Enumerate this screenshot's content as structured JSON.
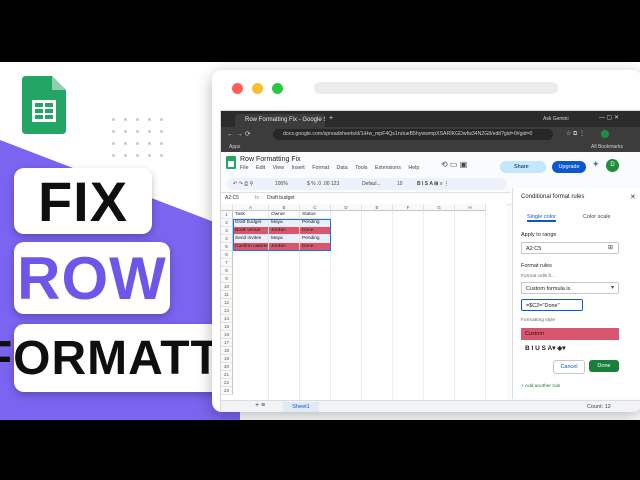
{
  "colors": {
    "purple": "#7b64f0",
    "accent": "#6f56e8",
    "sheets_green": "#1e8e3e",
    "rule_fill": "#d9576e"
  },
  "title": {
    "line1": "FIX",
    "line2": "ROW",
    "line3": "FORMATTING"
  },
  "browser": {
    "tab_title": "Row Formatting Fix - Google S",
    "tab_right": "Ask Gemini",
    "url": "docs.google.com/spreadsheets/d/1iHw_mpF4Qs1rutueB5hywwmpXSARIKGDwfw34N2G8/edit?gid=0#gid=0",
    "bookmarks_left": "Apps",
    "bookmarks_right": "All Bookmarks"
  },
  "sheets": {
    "doc_title": "Row Formatting Fix",
    "menu": [
      "File",
      "Edit",
      "View",
      "Insert",
      "Format",
      "Data",
      "Tools",
      "Extensions",
      "Help"
    ],
    "share_label": "Share",
    "upgrade_label": "Upgrade",
    "avatar_letter": "D",
    "zoom": "100%",
    "font": "Defaul...",
    "font_size": "10",
    "cell_ref": "A2:C5",
    "formula": "Draft budget",
    "columns": [
      "A",
      "B",
      "C",
      "D",
      "E",
      "F",
      "G",
      "H"
    ],
    "rows": [
      {
        "n": "1",
        "a": "Task",
        "b": "Owner",
        "c": "Status",
        "hl": false
      },
      {
        "n": "2",
        "a": "Draft budget",
        "b": "Maya",
        "c": "Pending",
        "hl": false
      },
      {
        "n": "3",
        "a": "Book venue",
        "b": "Jordan",
        "c": "Done",
        "hl": true
      },
      {
        "n": "4",
        "a": "Send invites",
        "b": "Maya",
        "c": "Pending",
        "hl": false
      },
      {
        "n": "5",
        "a": "Confirm caterer",
        "b": "Jordan",
        "c": "Done",
        "hl": true
      }
    ],
    "sheet_tab": "Sheet1",
    "count": "Count: 12"
  },
  "panel": {
    "title": "Conditional format rules",
    "tab_single": "Single color",
    "tab_scale": "Color scale",
    "apply_label": "Apply to range",
    "range": "A2:C5",
    "rules_label": "Format rules",
    "format_if": "Format cells if...",
    "condition": "Custom formula is",
    "formula_value": "=$C2=\"Done\"",
    "style_label": "Formatting style",
    "style_sample": "Custom",
    "cancel": "Cancel",
    "done": "Done",
    "add_rule": "+ Add another rule"
  }
}
